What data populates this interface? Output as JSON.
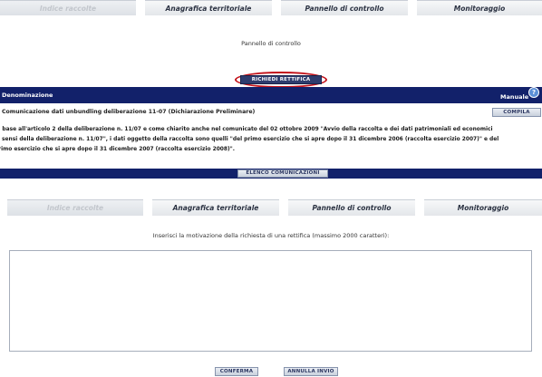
{
  "top_tabs": [
    {
      "label": "Indice raccolte",
      "state": "inactive"
    },
    {
      "label": "Anagrafica territoriale",
      "state": "active"
    },
    {
      "label": "Pannello di controllo",
      "state": "active"
    },
    {
      "label": "Monitoraggio",
      "state": "active"
    }
  ],
  "panel": {
    "heading": "Pannello di controllo",
    "rectify_button": "RICHIEDI RETTIFICA",
    "table": {
      "col_denominazione": "Denominazione",
      "col_manuale": "Manuale",
      "row_name": "Comunicazione dati unbundling deliberazione 11-07 (Dichiarazione Preliminare)",
      "row_action": "COMPILA"
    },
    "description_lines": [
      "In base all'articolo 2 della deliberazione n. 11/07 e come chiarito anche nel comunicato del 02 ottobre 2009 \"Avvio della raccolta e dei dati patrimoniali ed economici",
      "ai sensi della deliberazione n. 11/07\", i dati oggetto della raccolta sono quelli \"del primo esercizio che si apre dopo il 31 dicembre 2006 (raccolta esercizio 2007)\" e del",
      "primo esercizio che si apre dopo il 31 dicembre 2007 (raccolta esercizio 2008)\"."
    ],
    "list_button": "ELENCO COMUNICAZIONI"
  },
  "bottom_tabs": [
    {
      "label": "Indice raccolte",
      "state": "inactive"
    },
    {
      "label": "Anagrafica territoriale",
      "state": "active"
    },
    {
      "label": "Pannello di controllo",
      "state": "active"
    },
    {
      "label": "Monitoraggio",
      "state": "active"
    }
  ],
  "form": {
    "instruction": "Inserisci la motivazione della richiesta di una rettifica (massimo 2000 caratteri):",
    "textarea_value": "",
    "confirm_button": "CONFERMA",
    "cancel_button": "ANNULLA INVIO"
  },
  "colors": {
    "header_bar": "#12216a",
    "highlight_ellipse": "#c2131b",
    "help_icon": "#5b8fd6"
  },
  "icons": {
    "help": "question-circle-icon"
  }
}
